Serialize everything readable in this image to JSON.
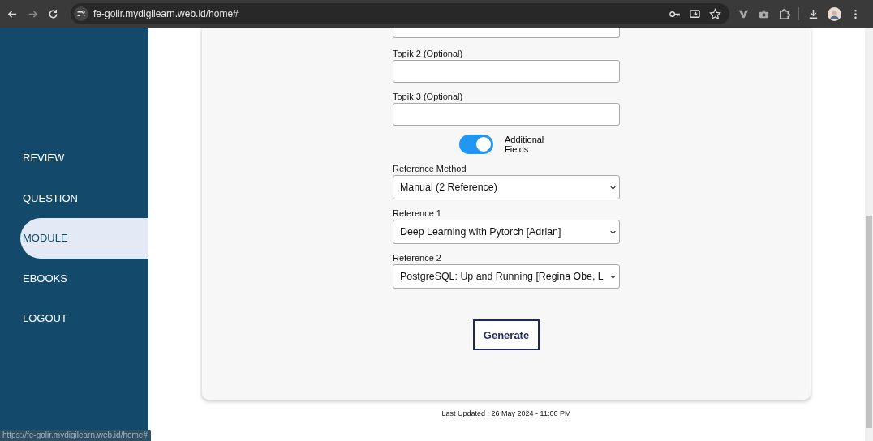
{
  "browser": {
    "url": "fe-golir.mydigilearn.web.id/home#",
    "status_url": "https://fe-golir.mydigilearn.web.id/home#"
  },
  "sidebar": {
    "items": [
      {
        "label": "REVIEW",
        "selected": false
      },
      {
        "label": "QUESTION",
        "selected": false
      },
      {
        "label": "MODULE",
        "selected": true
      },
      {
        "label": "EBOOKS",
        "selected": false
      },
      {
        "label": "LOGOUT",
        "selected": false
      }
    ]
  },
  "form": {
    "fields": [
      {
        "kind": "text",
        "label": "Topik 2 (Optional)"
      },
      {
        "kind": "text",
        "label": "Topik 3 (Optional)"
      },
      {
        "kind": "toggle",
        "label": "Additional Fields",
        "on": true
      },
      {
        "kind": "select",
        "label": "Reference Method",
        "value": "Manual (2 Reference)"
      },
      {
        "kind": "select",
        "label": "Reference 1",
        "value": "Deep Learning with Pytorch [Adrian]"
      },
      {
        "kind": "select",
        "label": "Reference 2",
        "value": "PostgreSQL: Up and Running [Regina Obe, L"
      }
    ],
    "submit": "Generate"
  },
  "footer": "Last Updated : 26 May 2024 - 11:00 PM"
}
